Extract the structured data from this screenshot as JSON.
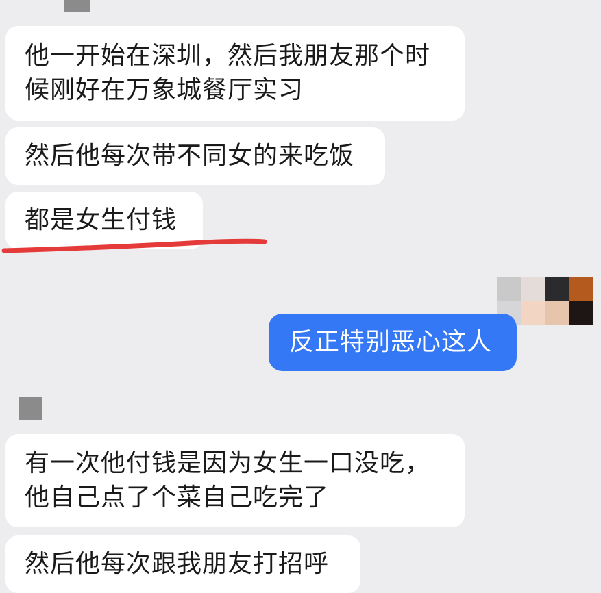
{
  "chat": {
    "messages": [
      {
        "side": "left",
        "lines": [
          "他一开始在深圳，然后我朋友那个时",
          "候刚好在万象城餐厅实习"
        ]
      },
      {
        "side": "left",
        "lines": [
          "然后他每次带不同女的来吃饭"
        ]
      },
      {
        "side": "left",
        "lines": [
          "都是女生付钱"
        ],
        "underlined": true
      },
      {
        "side": "right",
        "lines": [
          "反正特别恶心这人"
        ]
      },
      {
        "side": "left",
        "lines": [
          "有一次他付钱是因为女生一口没吃，",
          "他自己点了个菜自己吃完了"
        ]
      },
      {
        "side": "left",
        "lines": [
          "然后他每次跟我朋友打招呼"
        ]
      }
    ]
  },
  "colors": {
    "background": "#ededf0",
    "left_bubble": "#ffffff",
    "right_bubble": "#3478f6",
    "underline": "#e53a3a"
  },
  "icons": {
    "left_avatar": "avatar-icon",
    "right_avatar": "mosaic-avatar-icon"
  }
}
